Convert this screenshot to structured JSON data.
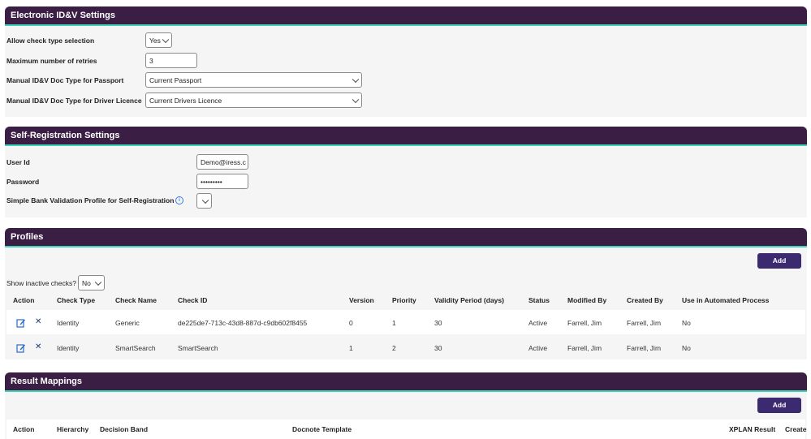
{
  "electronic": {
    "title": "Electronic ID&V Settings",
    "allow_label": "Allow check type selection",
    "allow_value": "Yes",
    "retries_label": "Maximum number of retries",
    "retries_value": "3",
    "passport_label": "Manual ID&V Doc Type for Passport",
    "passport_value": "Current Passport",
    "driver_label": "Manual ID&V Doc Type for Driver Licence",
    "driver_value": "Current Drivers Licence"
  },
  "selfreg": {
    "title": "Self-Registration Settings",
    "user_label": "User Id",
    "user_value": "Demo@iress.c",
    "password_label": "Password",
    "password_value": "•••••••••",
    "bank_label": "Simple Bank Validation Profile for Self-Registration",
    "info_glyph": "i"
  },
  "profiles": {
    "title": "Profiles",
    "add_label": "Add",
    "inactive_label": "Show inactive checks?",
    "inactive_value": "No",
    "columns": [
      "Action",
      "Check Type",
      "Check Name",
      "Check ID",
      "Version",
      "Priority",
      "Validity Period (days)",
      "Status",
      "Modified By",
      "Created By",
      "Use in Automated Process"
    ],
    "rows": [
      [
        "Identity",
        "Generic",
        "de225de7-713c-43d8-887d-c9db602f8455",
        "0",
        "1",
        "30",
        "Active",
        "Farrell, Jim",
        "Farrell, Jim",
        "No"
      ],
      [
        "Identity",
        "SmartSearch",
        "SmartSearch",
        "1",
        "2",
        "30",
        "Active",
        "Farrell, Jim",
        "Farrell, Jim",
        "No"
      ]
    ],
    "delete_glyph": "✕"
  },
  "mappings": {
    "title": "Result Mappings",
    "add_label": "Add",
    "columns": [
      "Action",
      "Hierarchy",
      "Decision Band",
      "Docnote Template",
      "XPLAN Result",
      "Create"
    ]
  }
}
